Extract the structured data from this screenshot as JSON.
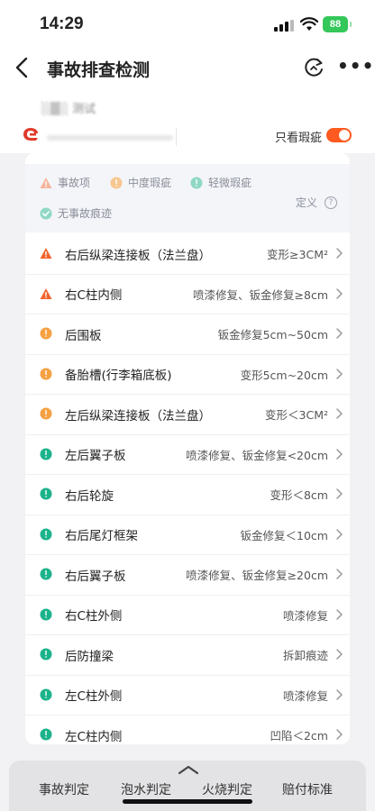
{
  "status_bar": {
    "time": "14:29",
    "battery": "88"
  },
  "nav": {
    "title": "事故排查检测"
  },
  "header": {
    "car_name_blurred": "░▒░ 测试",
    "toggle_label": "只看瑕疵",
    "toggle_on": true
  },
  "legend": {
    "accident": "事故项",
    "moderate": "中度瑕疵",
    "minor": "轻微瑕疵",
    "no_trace": "无事故痕迹",
    "definition": "定义",
    "question_mark": "?"
  },
  "colors": {
    "accident": "#f0642d",
    "moderate": "#f5a042",
    "minor": "#1bb38a",
    "toggle": "#ff5a1f"
  },
  "items": [
    {
      "name": "右后纵梁连接板（法兰盘）",
      "desc": "变形≥3CM²",
      "level": "accident"
    },
    {
      "name": "右C柱内侧",
      "desc": "喷漆修复、钣金修复≥8cm",
      "level": "accident"
    },
    {
      "name": "后围板",
      "desc": "钣金修复5cm~50cm",
      "level": "moderate"
    },
    {
      "name": "备胎槽(行李箱底板)",
      "desc": "变形5cm~20cm",
      "level": "moderate"
    },
    {
      "name": "左后纵梁连接板（法兰盘）",
      "desc": "变形＜3CM²",
      "level": "moderate"
    },
    {
      "name": "左后翼子板",
      "desc": "喷漆修复、钣金修复<20cm",
      "level": "minor"
    },
    {
      "name": "右后轮旋",
      "desc": "变形＜8cm",
      "level": "minor"
    },
    {
      "name": "右后尾灯框架",
      "desc": "钣金修复＜10cm",
      "level": "minor"
    },
    {
      "name": "右后翼子板",
      "desc": "喷漆修复、钣金修复≥20cm",
      "level": "minor"
    },
    {
      "name": "右C柱外侧",
      "desc": "喷漆修复",
      "level": "minor"
    },
    {
      "name": "后防撞梁",
      "desc": "拆卸痕迹",
      "level": "minor"
    },
    {
      "name": "左C柱外侧",
      "desc": "喷漆修复",
      "level": "minor"
    },
    {
      "name": "左C柱内侧",
      "desc": "凹陷＜2cm",
      "level": "minor"
    }
  ],
  "bottom_tabs": [
    "事故判定",
    "泡水判定",
    "火烧判定",
    "赔付标准"
  ]
}
